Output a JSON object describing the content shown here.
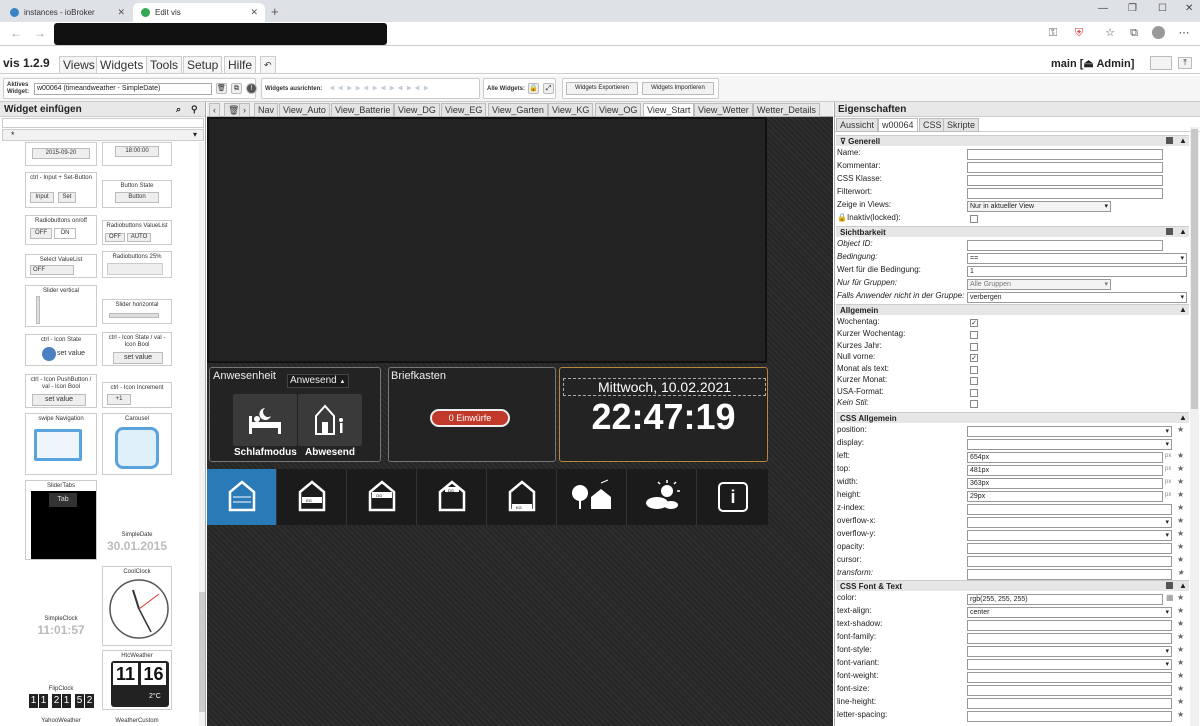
{
  "browser": {
    "tabs": [
      {
        "title": "instances - ioBroker"
      },
      {
        "title": "Edit vis"
      }
    ],
    "new_tab": "+"
  },
  "vis": {
    "title": "vis 1.2.9",
    "menu": [
      "Views",
      "Widgets",
      "Tools",
      "Setup",
      "Hilfe"
    ],
    "undo": "↶",
    "user": "main [",
    "user_icon": "⏏",
    "user_name": "Admin]"
  },
  "toolbar": {
    "active_widget_label": "Aktives Widget:",
    "active_widget_value": "w00064 (timeandweather - SimpleDate)",
    "align_label": "Widgets ausrichten:",
    "all_widgets_label": "Alle Widgets:",
    "export_label": "Widgets Exportieren",
    "import_label": "Widgets Importieren"
  },
  "left": {
    "header": "Widget einfügen",
    "filter_value": "*",
    "widgets": {
      "date_val": "2015-09-20",
      "time_val": "18:00:00",
      "input_set_title": "ctrl - Input + Set-Button",
      "input_label": "Input",
      "set_label": "Set",
      "button_state_title": "Button State",
      "button_label": "Button",
      "radio_onoff_title": "Radiobuttons on/off",
      "off": "OFF",
      "on": "ON",
      "radio_list_title": "Radiobuttons ValueList",
      "auto": "AUTO",
      "select_title": "Select ValueList",
      "radio25_title": "Radiobuttons 25%",
      "slider_v_title": "Slider vertical",
      "slider_h_title": "Slider horizontal",
      "icon_state_title": "ctrl - Icon State",
      "icon_bool_title": "ctrl - Icon State / val - Icon Bool",
      "set_value": "set value",
      "push_title": "ctrl - Icon PushButton / val - Icon Bool",
      "increment_title": "ctrl - Icon Increment",
      "plus_one": "+1",
      "swipe_title": "swipe Navigation",
      "carousel_title": "Carousel",
      "slidertabs_title": "SliderTabs",
      "tab_label": "Tab",
      "simpledate_title": "SimpleDate",
      "simpledate_val": "30.01.2015",
      "coolclock_title": "CoolClock",
      "simpleclock_title": "SimpleClock",
      "simpleclock_val": "11:01:57",
      "htcweather_title": "HtcWeather",
      "htc_h": "11",
      "htc_m": "16",
      "htc_temp": "2°C",
      "flipclock_title": "FlipClock",
      "flip_digits": [
        "1",
        "1",
        "2",
        "1",
        "5",
        "2"
      ],
      "yahoo_title": "YahooWeather",
      "weathercustom_title": "WeatherCustom"
    }
  },
  "views": {
    "tabs": [
      "Nav",
      "View_Auto",
      "View_Batterie",
      "View_DG",
      "View_EG",
      "View_Garten",
      "View_KG",
      "View_OG",
      "View_Start",
      "View_Wetter",
      "Wetter_Details"
    ],
    "active": "View_Start"
  },
  "canvas": {
    "anwesenheit_title": "Anwesenheit",
    "anwesend_dropdown": "Anwesend",
    "sleep_label": "Schlafmodus",
    "away_label": "Abwesend",
    "briefkasten_title": "Briefkasten",
    "briefkasten_button": "0 Einwürfe",
    "date_text": "Mittwoch, 10.02.2021",
    "time_text": "22:47:19",
    "nav_labels": [
      "",
      "EG",
      "OG",
      "DG",
      "KG",
      "",
      "",
      "i"
    ]
  },
  "props": {
    "header": "Eigenschaften",
    "tabs": [
      "Aussicht",
      "w00064",
      "CSS",
      "Skripte"
    ],
    "sections": {
      "generell": "Generell",
      "sichtbarkeit": "Sichtbarkeit",
      "allgemein": "Allgemein",
      "css_allgemein": "CSS Allgemein",
      "css_font": "CSS Font & Text"
    },
    "generell": {
      "name": "Name:",
      "kommentar": "Kommentar:",
      "css_klasse": "CSS Klasse:",
      "filterwort": "Filterwort:",
      "zeige": "Zeige in Views:",
      "zeige_val": "Nur in aktueller View",
      "inaktiv": "Inaktiv(locked):"
    },
    "sicht": {
      "objid": "Object ID:",
      "bedingung": "Bedingung:",
      "bedingung_val": "==",
      "wert": "Wert für die Bedingung:",
      "wert_val": "1",
      "gruppen": "Nur für Gruppen:",
      "gruppen_val": "Alle Gruppen",
      "falls": "Falls Anwender nicht in der Gruppe:",
      "falls_val": "verbergen"
    },
    "allg": {
      "wochentag": "Wochentag:",
      "kurz_wochentag": "Kurzer Wochentag:",
      "kurz_jahr": "Kurzes Jahr:",
      "null_vorne": "Null vorne:",
      "monat_text": "Monat als text:",
      "kurz_monat": "Kurzer Monat:",
      "usa": "USA-Format:",
      "kein_stil": "Kein Stil:"
    },
    "cssa": {
      "position": "position:",
      "display": "display:",
      "left": "left:",
      "left_val": "654px",
      "top": "top:",
      "top_val": "481px",
      "width": "width:",
      "width_val": "363px",
      "height": "height:",
      "height_val": "29px",
      "zindex": "z-index:",
      "ovx": "overflow-x:",
      "ovy": "overflow-y:",
      "opacity": "opacity:",
      "cursor": "cursor:",
      "transform": "transform:",
      "px": "px"
    },
    "cssf": {
      "color": "color:",
      "color_val": "rgb(255, 255, 255)",
      "align": "text-align:",
      "align_val": "center",
      "shadow": "text-shadow:",
      "family": "font-family:",
      "style": "font-style:",
      "variant": "font-variant:",
      "weight": "font-weight:",
      "size": "font-size:",
      "lheight": "line-height:",
      "lspacing": "letter-spacing:"
    }
  },
  "colors": {
    "accent": "#2a7ab8",
    "red_button": "#c0392b"
  }
}
